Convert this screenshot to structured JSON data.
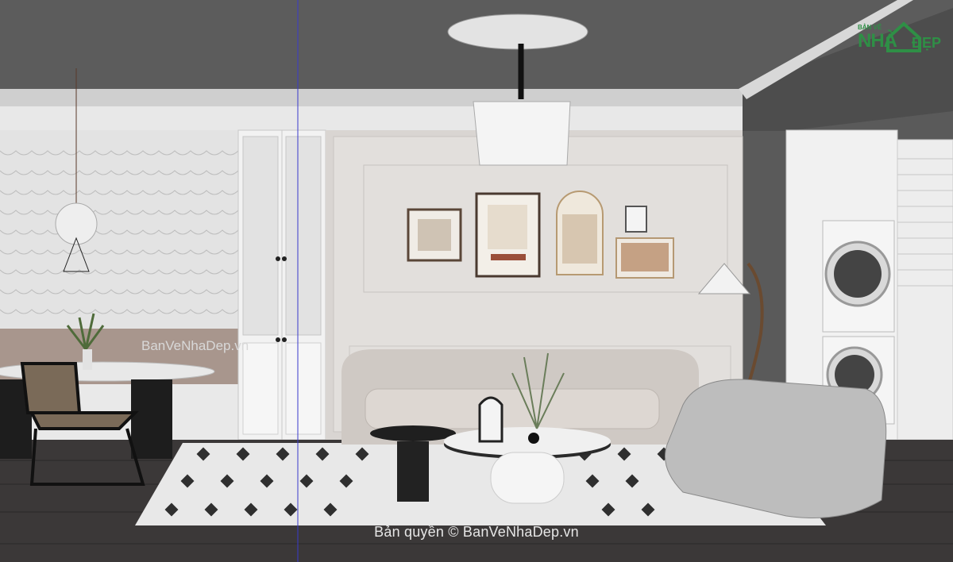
{
  "watermarks": {
    "center": "Bản quyền © BanVeNhaDep.vn",
    "left": "BanVeNhaDep.vn"
  },
  "logo": {
    "top_small": "BẢN VẼ",
    "main": "NHÀ",
    "tail": "ĐẸP"
  },
  "colors": {
    "ceiling": "#5c5c5c",
    "wall": "#d9d5d2",
    "floor": "#3b3838",
    "rug": "#eaeaea",
    "logo_green": "#2f8f46",
    "guide_line": "#3a3acc"
  }
}
